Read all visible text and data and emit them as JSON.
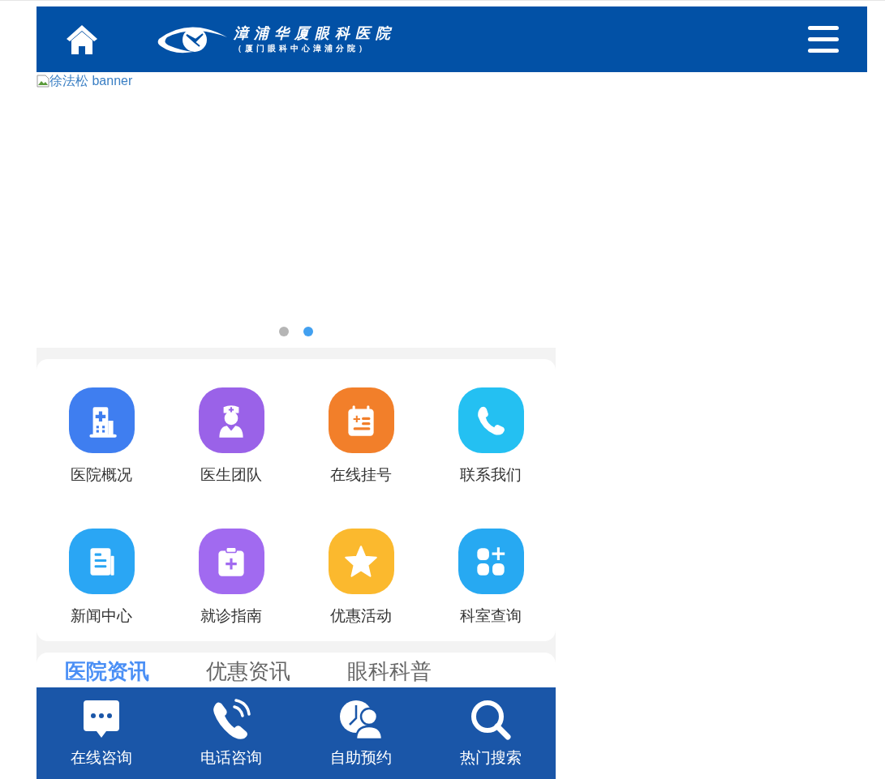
{
  "header": {
    "logo_title": "漳浦华厦眼科医院",
    "logo_subtitle": "（厦门眼科中心漳浦分院）"
  },
  "banner": {
    "alt": "徐法松 banner",
    "dots": [
      {
        "selected": false
      },
      {
        "selected": true
      }
    ]
  },
  "shortcuts": [
    {
      "label": "医院概况",
      "color": "#3f7ef0"
    },
    {
      "label": "医生团队",
      "color": "#9a62e8"
    },
    {
      "label": "在线挂号",
      "color": "#f27f2a"
    },
    {
      "label": "联系我们",
      "color": "#24c0f2"
    },
    {
      "label": "新闻中心",
      "color": "#2aa6f4"
    },
    {
      "label": "就诊指南",
      "color": "#a16af0"
    },
    {
      "label": "优惠活动",
      "color": "#fbb92e"
    },
    {
      "label": "科室查询",
      "color": "#27a9f2"
    }
  ],
  "news_tabs": [
    {
      "label": "医院资讯",
      "selected": true
    },
    {
      "label": "优惠资讯",
      "selected": false
    },
    {
      "label": "眼科科普",
      "selected": false
    }
  ],
  "bottom_bar": [
    {
      "label": "在线咨询"
    },
    {
      "label": "电话咨询"
    },
    {
      "label": "自助预约"
    },
    {
      "label": "热门搜索"
    }
  ]
}
